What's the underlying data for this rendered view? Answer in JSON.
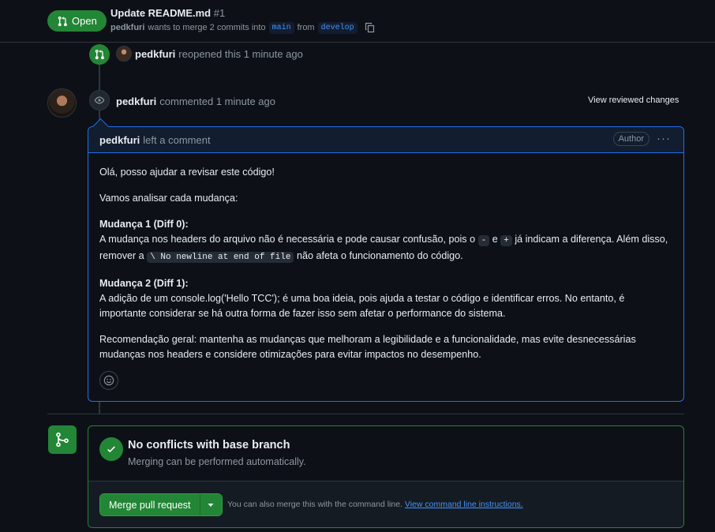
{
  "header": {
    "state_label": "Open",
    "title": "Update README.md",
    "number": "#1",
    "author": "pedkfuri",
    "merge_text": "wants to merge 2 commits into",
    "base_branch": "main",
    "from_text": "from",
    "head_branch": "develop"
  },
  "events": {
    "reopened": {
      "user": "pedkfuri",
      "text": "reopened this 1 minute ago"
    },
    "commented": {
      "user": "pedkfuri",
      "text": "commented 1 minute ago",
      "view_changes": "View reviewed changes"
    }
  },
  "comment": {
    "user": "pedkfuri",
    "action": "left a comment",
    "badge": "Author",
    "greeting": "Olá, posso ajudar a revisar este código!",
    "intro": "Vamos analisar cada mudança:",
    "change1_title": "Mudança 1 (Diff 0):",
    "change1_text_a": "A mudança nos headers do arquivo não é necessária e pode causar confusão, pois o",
    "change1_code_minus": "-",
    "change1_text_b": "e",
    "change1_code_plus": "+",
    "change1_text_c": "já indicam a diferença. Além disso, remover a",
    "change1_code_newline": "\\ No newline at end of file",
    "change1_text_d": "não afeta o funcionamento do código.",
    "change2_title": "Mudança 2 (Diff 1):",
    "change2_text": "A adição de um console.log('Hello TCC'); é uma boa ideia, pois ajuda a testar o código e identificar erros. No entanto, é importante considerar se há outra forma de fazer isso sem afetar o performance do sistema.",
    "recommendation": "Recomendação geral: mantenha as mudanças que melhoram a legibilidade e a funcionalidade, mas evite desnecessárias mudanças nos headers e considere otimizações para evitar impactos no desempenho."
  },
  "merge": {
    "title": "No conflicts with base branch",
    "subtitle": "Merging can be performed automatically.",
    "button": "Merge pull request",
    "hint": "You can also merge this with the command line.",
    "hint_link": "View command line instructions."
  },
  "colors": {
    "green": "#238636",
    "blue": "#1f6feb",
    "link": "#4493f8",
    "bg": "#0d1117"
  }
}
